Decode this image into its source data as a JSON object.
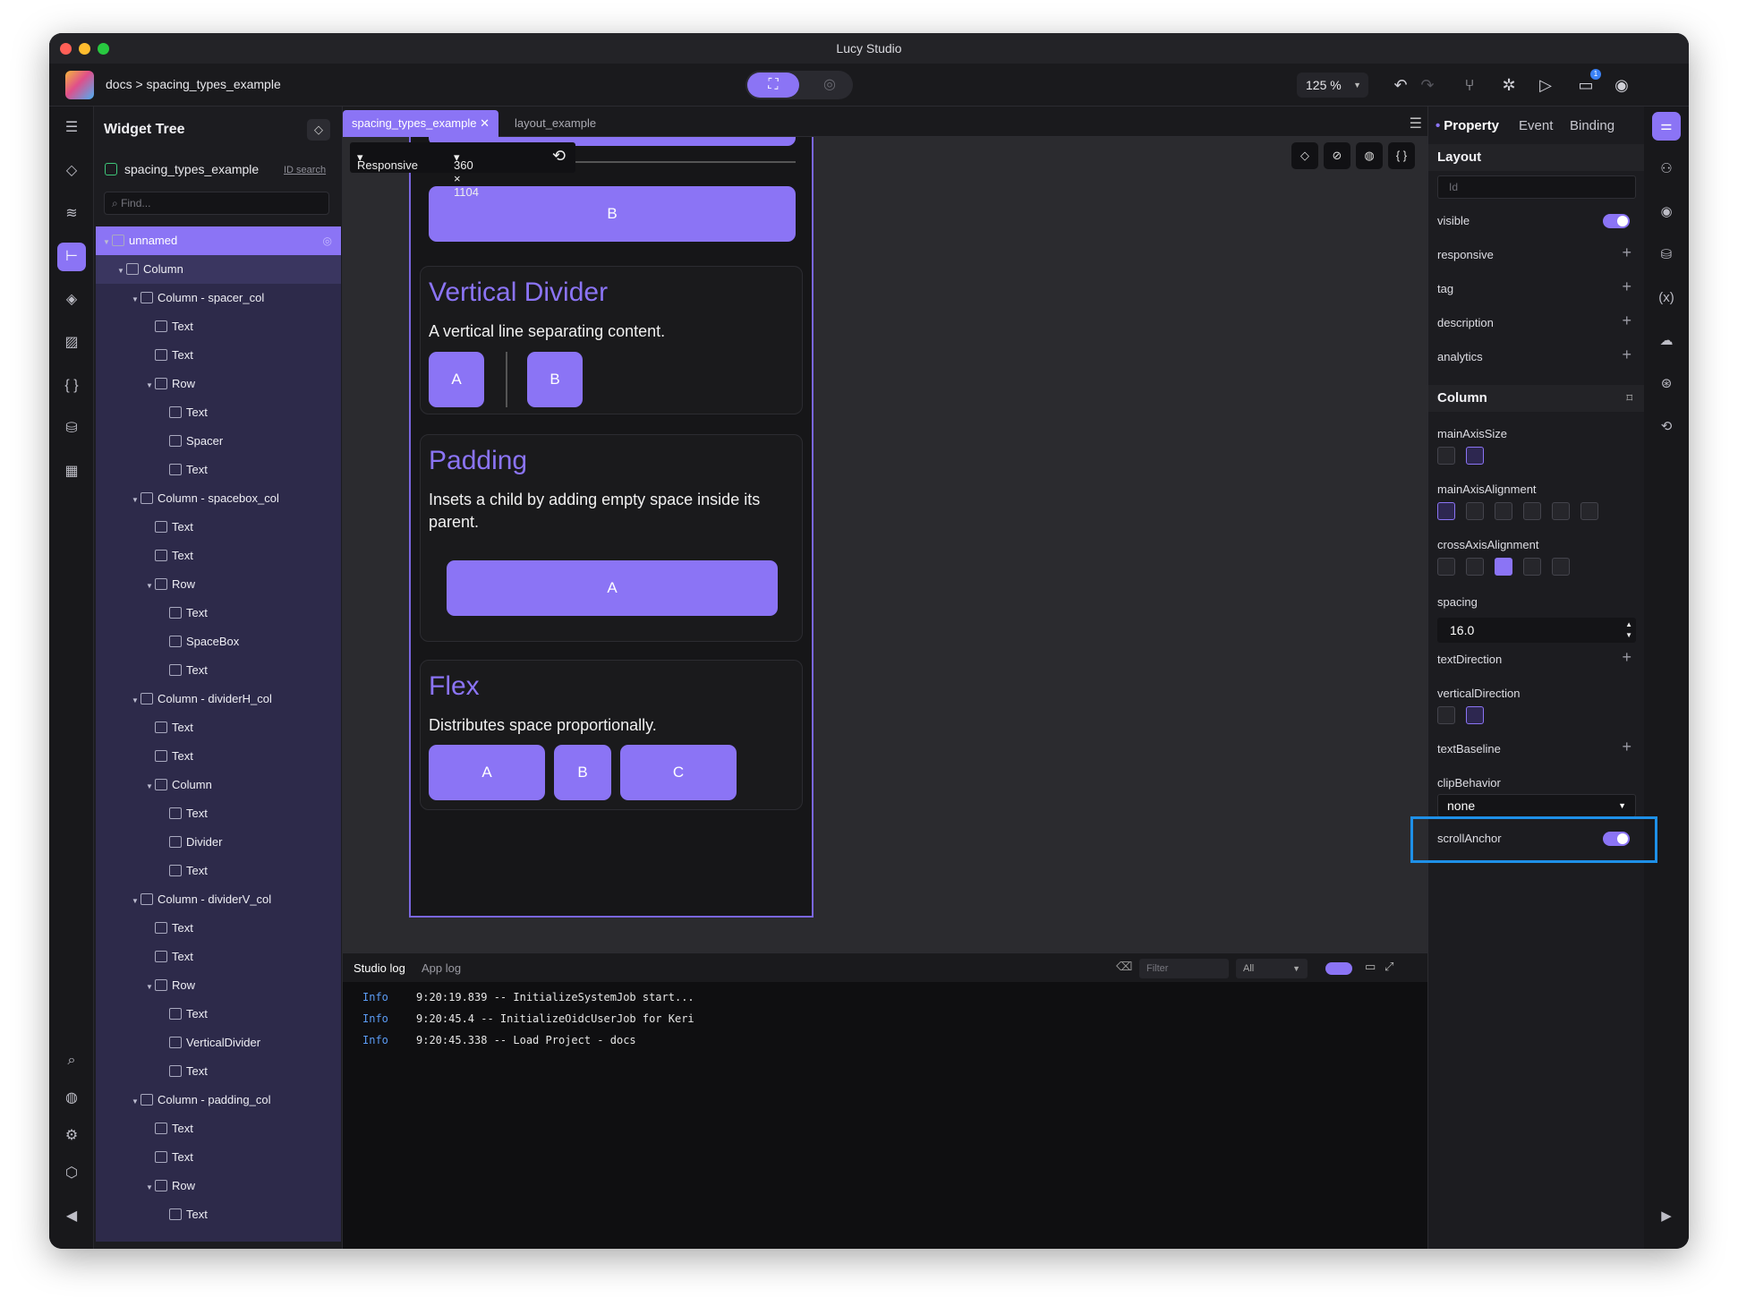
{
  "window": {
    "title": "Lucy Studio"
  },
  "toolbar": {
    "breadcrumb": "docs > spacing_types_example",
    "zoom": "125 %",
    "notifications_badge": "1"
  },
  "tree_panel": {
    "title": "Widget Tree",
    "project_name": "spacing_types_example",
    "id_search": "ID search",
    "find_placeholder": "Find...",
    "nodes": [
      {
        "label": "unnamed",
        "depth": 0,
        "expanded": true
      },
      {
        "label": "Column",
        "depth": 1,
        "expanded": true
      },
      {
        "label": "Column - spacer_col",
        "depth": 2,
        "expanded": true
      },
      {
        "label": "Text",
        "depth": 3
      },
      {
        "label": "Text",
        "depth": 3
      },
      {
        "label": "Row",
        "depth": 3,
        "expanded": true
      },
      {
        "label": "Text",
        "depth": 4
      },
      {
        "label": "Spacer",
        "depth": 4
      },
      {
        "label": "Text",
        "depth": 4
      },
      {
        "label": "Column - spacebox_col",
        "depth": 2,
        "expanded": true
      },
      {
        "label": "Text",
        "depth": 3
      },
      {
        "label": "Text",
        "depth": 3
      },
      {
        "label": "Row",
        "depth": 3,
        "expanded": true
      },
      {
        "label": "Text",
        "depth": 4
      },
      {
        "label": "SpaceBox",
        "depth": 4
      },
      {
        "label": "Text",
        "depth": 4
      },
      {
        "label": "Column - dividerH_col",
        "depth": 2,
        "expanded": true
      },
      {
        "label": "Text",
        "depth": 3
      },
      {
        "label": "Text",
        "depth": 3
      },
      {
        "label": "Column",
        "depth": 3,
        "expanded": true
      },
      {
        "label": "Text",
        "depth": 4
      },
      {
        "label": "Divider",
        "depth": 4
      },
      {
        "label": "Text",
        "depth": 4
      },
      {
        "label": "Column - dividerV_col",
        "depth": 2,
        "expanded": true
      },
      {
        "label": "Text",
        "depth": 3
      },
      {
        "label": "Text",
        "depth": 3
      },
      {
        "label": "Row",
        "depth": 3,
        "expanded": true
      },
      {
        "label": "Text",
        "depth": 4
      },
      {
        "label": "VerticalDivider",
        "depth": 4
      },
      {
        "label": "Text",
        "depth": 4
      },
      {
        "label": "Column - padding_col",
        "depth": 2,
        "expanded": true
      },
      {
        "label": "Text",
        "depth": 3
      },
      {
        "label": "Text",
        "depth": 3
      },
      {
        "label": "Row",
        "depth": 3,
        "expanded": true
      },
      {
        "label": "Text",
        "depth": 4
      }
    ]
  },
  "tabs": [
    {
      "label": "spacing_types_example",
      "active": true
    },
    {
      "label": "layout_example",
      "active": false
    }
  ],
  "canvas": {
    "responsive": "Responsive",
    "size": "360 × 1104",
    "top_button": "B",
    "vertical_divider": {
      "title": "Vertical Divider",
      "desc": "A vertical line separating content.",
      "a": "A",
      "b": "B"
    },
    "padding": {
      "title": "Padding",
      "desc": "Insets a child by adding empty space inside its parent.",
      "a": "A"
    },
    "flex": {
      "title": "Flex",
      "desc": "Distributes space proportionally.",
      "a": "A",
      "b": "B",
      "c": "C"
    }
  },
  "log": {
    "tabs": [
      "Studio log",
      "App log"
    ],
    "filter_placeholder": "Filter",
    "level": "All",
    "lines": [
      {
        "level": "Info",
        "text": "9:20:19.839 -- InitializeSystemJob start..."
      },
      {
        "level": "Info",
        "text": "9:20:45.4 -- InitializeOidcUserJob for Keri"
      },
      {
        "level": "Info",
        "text": "9:20:45.338 -- Load Project - docs"
      }
    ]
  },
  "props": {
    "tabs": [
      "Property",
      "Event",
      "Binding"
    ],
    "layout_section": "Layout",
    "id_placeholder": "Id",
    "visible": "visible",
    "responsive": "responsive",
    "tag": "tag",
    "description": "description",
    "analytics": "analytics",
    "column_section": "Column",
    "mainAxisSize": "mainAxisSize",
    "mainAxisAlignment": "mainAxisAlignment",
    "crossAxisAlignment": "crossAxisAlignment",
    "spacing": "spacing",
    "spacing_value": "16.0",
    "textDirection": "textDirection",
    "verticalDirection": "verticalDirection",
    "textBaseline": "textBaseline",
    "clipBehavior": "clipBehavior",
    "clip_value": "none",
    "scrollAnchor": "scrollAnchor"
  },
  "colors": {
    "accent": "#8b74f5",
    "highlight": "#1e90e8",
    "background": "#1c1c20"
  }
}
